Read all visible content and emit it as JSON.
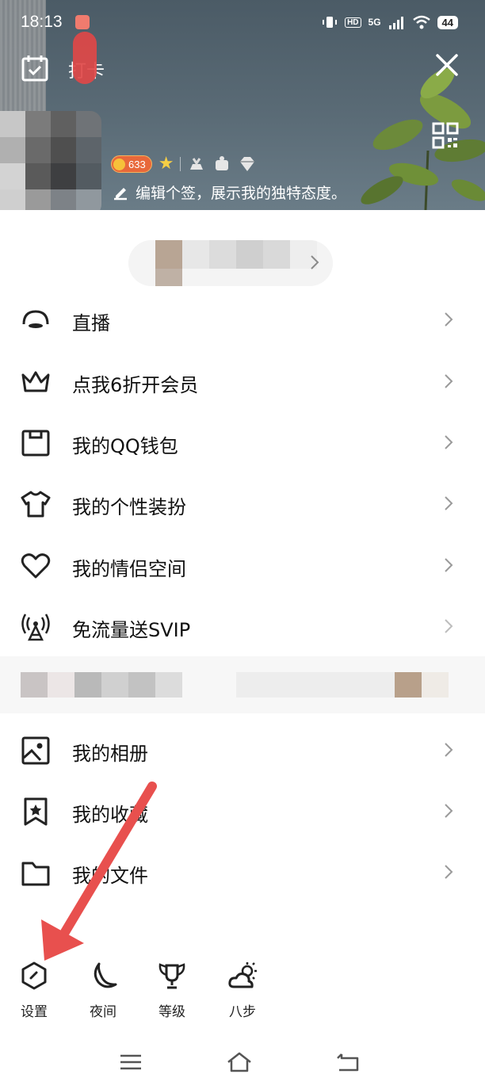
{
  "status_bar": {
    "time": "18:13",
    "network": "5G",
    "hd": "HD",
    "battery": "44"
  },
  "header": {
    "checkin_label": "打卡",
    "coin_count": "633",
    "signature": "编辑个签，展示我的独特态度。"
  },
  "menu": {
    "items": [
      {
        "label": "直播",
        "icon": "live-icon"
      },
      {
        "label": "点我6折开会员",
        "icon": "crown-icon"
      },
      {
        "label": "我的QQ钱包",
        "icon": "wallet-icon"
      },
      {
        "label": "我的个性装扮",
        "icon": "tshirt-icon"
      },
      {
        "label": "我的情侣空间",
        "icon": "heart-icon"
      },
      {
        "label": "免流量送SVIP",
        "icon": "antenna-icon"
      },
      {
        "label": "我的相册",
        "icon": "photo-album-icon"
      },
      {
        "label": "我的收藏",
        "icon": "bookmark-star-icon"
      },
      {
        "label": "我的文件",
        "icon": "folder-icon"
      }
    ]
  },
  "shortcuts": [
    {
      "label": "设置",
      "icon": "settings-hexagon-icon"
    },
    {
      "label": "夜间",
      "icon": "moon-icon"
    },
    {
      "label": "等级",
      "icon": "level-trophy-icon"
    },
    {
      "label": "八步",
      "icon": "weather-cloud-sun-icon"
    }
  ],
  "nav_bar": {
    "icons": [
      "menu-icon",
      "home-icon",
      "back-icon"
    ]
  },
  "colors": {
    "annotation_arrow": "#e8504e",
    "header_bg": "#56676f",
    "coin_badge": "#e8683a"
  }
}
